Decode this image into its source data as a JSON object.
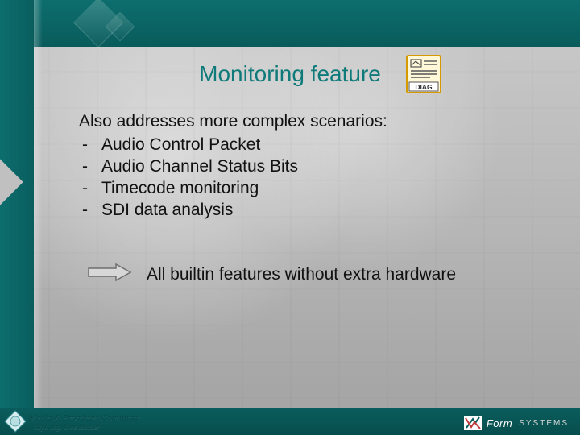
{
  "title": "Monitoring feature",
  "diag_icon_label": "DIAG",
  "intro": "Also addresses more complex scenarios:",
  "bullets": [
    "Audio Control Packet",
    "Audio Channel Status Bits",
    "Timecode monitoring",
    "SDI data analysis"
  ],
  "bullet_dash": "-",
  "callout": "All builtin features without extra hardware",
  "footer": {
    "consultant_line1": "Media & Broadcast Consultant",
    "consultant_line2": "Dipl. Ing. Uwe Harder",
    "brand_name": "Form",
    "brand_suffix": "SYSTEMS"
  },
  "colors": {
    "teal": "#0d6e6e",
    "title": "#0f7a7a",
    "diag_border": "#d69a00"
  }
}
